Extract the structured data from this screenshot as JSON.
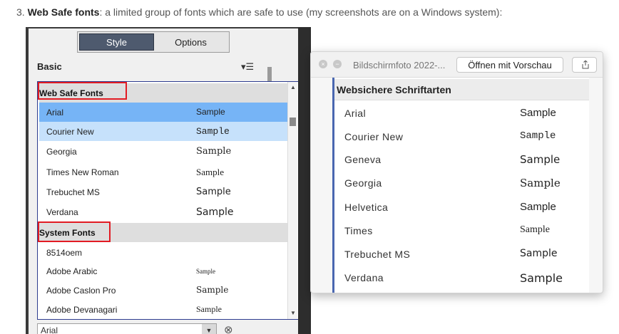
{
  "caption": {
    "prefix": "3. ",
    "bold": "Web Safe fonts",
    "rest": ": a limited group of fonts which are safe to use (my screenshots are on a Windows system):"
  },
  "windows_panel": {
    "tabs": [
      {
        "label": "Style",
        "active": true
      },
      {
        "label": "Options",
        "active": false
      }
    ],
    "section_label": "Basic",
    "menu_icon": "hamburger-sort-icon",
    "dropdown": {
      "groups": [
        {
          "header": "Web Safe Fonts",
          "items": [
            {
              "name": "Arial",
              "sample": "Sample",
              "state": "selected"
            },
            {
              "name": "Courier New",
              "sample": "Sample",
              "state": "hover"
            },
            {
              "name": "Georgia",
              "sample": "Sample",
              "state": ""
            },
            {
              "name": "Times New Roman",
              "sample": "Sample",
              "state": ""
            },
            {
              "name": "Trebuchet MS",
              "sample": "Sample",
              "state": ""
            },
            {
              "name": "Verdana",
              "sample": "Sample",
              "state": ""
            }
          ]
        },
        {
          "header": "System Fonts",
          "items": [
            {
              "name": "8514oem",
              "sample": "",
              "state": ""
            },
            {
              "name": "Adobe Arabic",
              "sample": "Sample",
              "state": ""
            },
            {
              "name": "Adobe Caslon Pro",
              "sample": "Sample",
              "state": ""
            },
            {
              "name": "Adobe Devanagari",
              "sample": "Sample",
              "state": ""
            }
          ]
        }
      ]
    },
    "font_select_value": "Arial",
    "highlight_color": "#e21b23",
    "selected_color": "#76b4f6"
  },
  "mac_window": {
    "filename": "Bildschirmfoto 2022-...",
    "open_button": "Öffnen mit Vorschau",
    "share_icon": "share-icon",
    "list_header": "Websichere Schriftarten",
    "items": [
      {
        "name": "Arial",
        "sample": "Sample"
      },
      {
        "name": "Courier New",
        "sample": "Sample"
      },
      {
        "name": "Geneva",
        "sample": "Sample"
      },
      {
        "name": "Georgia",
        "sample": "Sample"
      },
      {
        "name": "Helvetica",
        "sample": "Sample"
      },
      {
        "name": "Times",
        "sample": "Sample"
      },
      {
        "name": "Trebuchet MS",
        "sample": "Sample"
      },
      {
        "name": "Verdana",
        "sample": "Sample"
      }
    ],
    "accent_color": "#4a67b0"
  }
}
